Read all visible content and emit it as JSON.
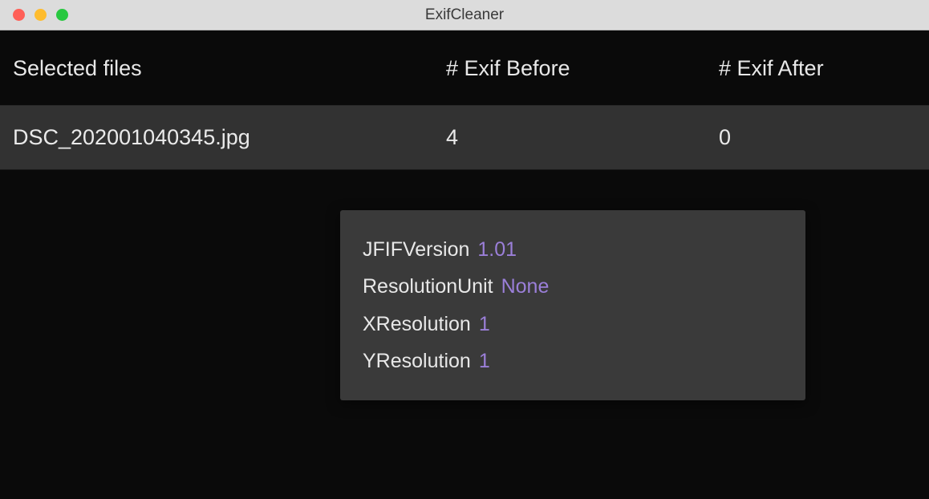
{
  "window": {
    "title": "ExifCleaner"
  },
  "headers": {
    "files": "Selected files",
    "before": "# Exif Before",
    "after": "# Exif After"
  },
  "rows": [
    {
      "filename": "DSC_202001040345.jpg",
      "before": "4",
      "after": "0"
    }
  ],
  "tooltip": {
    "items": [
      {
        "key": "JFIFVersion",
        "value": "1.01"
      },
      {
        "key": "ResolutionUnit",
        "value": "None"
      },
      {
        "key": "XResolution",
        "value": "1"
      },
      {
        "key": "YResolution",
        "value": "1"
      }
    ]
  }
}
